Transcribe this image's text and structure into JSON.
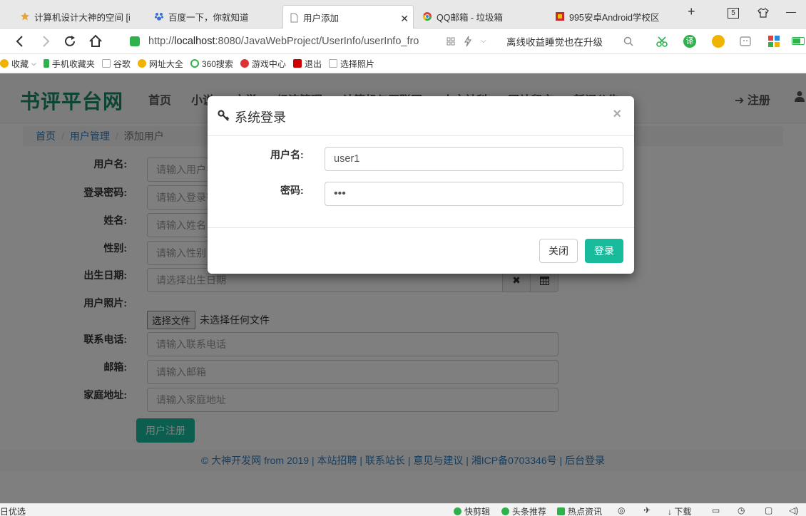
{
  "browser": {
    "tabs": [
      {
        "label": "计算机设计大神的空间 [i",
        "color": "#e8a33b"
      },
      {
        "label": "百度一下，你就知道",
        "color": "#3b6fd6"
      },
      {
        "label": "用户添加",
        "color": "#888888"
      },
      {
        "label": "QQ邮箱 - 垃圾箱",
        "color": "#2a8ad8"
      },
      {
        "label": "995安卓Android学校区",
        "color": "#c72a2a"
      }
    ],
    "new_tab": "+",
    "tab_count": "5",
    "minimize": "—",
    "url_prefix": "http://",
    "url_host": "localhost",
    "url_rest": ":8080/JavaWebProject/UserInfo/userInfo_fro",
    "search_text": "离线收益睡觉也在升级"
  },
  "bookmarks": [
    {
      "label": "收藏",
      "color": "#f0b400"
    },
    {
      "label": "手机收藏夹",
      "color": "#2fb24c"
    },
    {
      "label": "谷歌",
      "color": "#aaaaaa"
    },
    {
      "label": "网址大全",
      "color": "#f0b400"
    },
    {
      "label": "360搜索",
      "color": "#2fb24c"
    },
    {
      "label": "游戏中心",
      "color": "#d33"
    },
    {
      "label": "退出",
      "color": "#c00"
    },
    {
      "label": "选择照片",
      "color": "#aaaaaa"
    }
  ],
  "site": {
    "brand": "书评平台网",
    "nav": [
      "首页",
      "小说",
      "文学",
      "经济管理",
      "计算机与互联网",
      "人文社科",
      "网站留言",
      "新闻公告"
    ],
    "register": "注册"
  },
  "breadcrumb": {
    "home": "首页",
    "section": "用户管理",
    "current": "添加用户"
  },
  "form": {
    "username_label": "用户名:",
    "username_ph": "请输入用户名",
    "password_label": "登录密码:",
    "password_ph": "请输入登录密码",
    "name_label": "姓名:",
    "name_ph": "请输入姓名",
    "gender_label": "性别:",
    "gender_ph": "请输入性别",
    "birth_label": "出生日期:",
    "birth_ph": "请选择出生日期",
    "clear_icon": "✖",
    "photo_label": "用户照片:",
    "file_button": "选择文件",
    "file_status": "未选择任何文件",
    "phone_label": "联系电话:",
    "phone_ph": "请输入联系电话",
    "email_label": "邮箱:",
    "email_ph": "请输入邮箱",
    "address_label": "家庭地址:",
    "address_ph": "请输入家庭地址",
    "submit": "用户注册"
  },
  "footer": "© 大神开发网 from 2019 | 本站招聘 | 联系站长 | 意见与建议 | 湘ICP备0703346号 | 后台登录",
  "modal": {
    "title": "系统登录",
    "close_x": "×",
    "username_label": "用户名:",
    "username_value": "user1",
    "password_label": "密码:",
    "password_value": "•••",
    "close_button": "关闭",
    "login_button": "登录"
  },
  "statusbar": {
    "left": "日优选",
    "items": [
      "快剪辑",
      "头条推荐",
      "热点资讯"
    ],
    "download": "下载"
  }
}
